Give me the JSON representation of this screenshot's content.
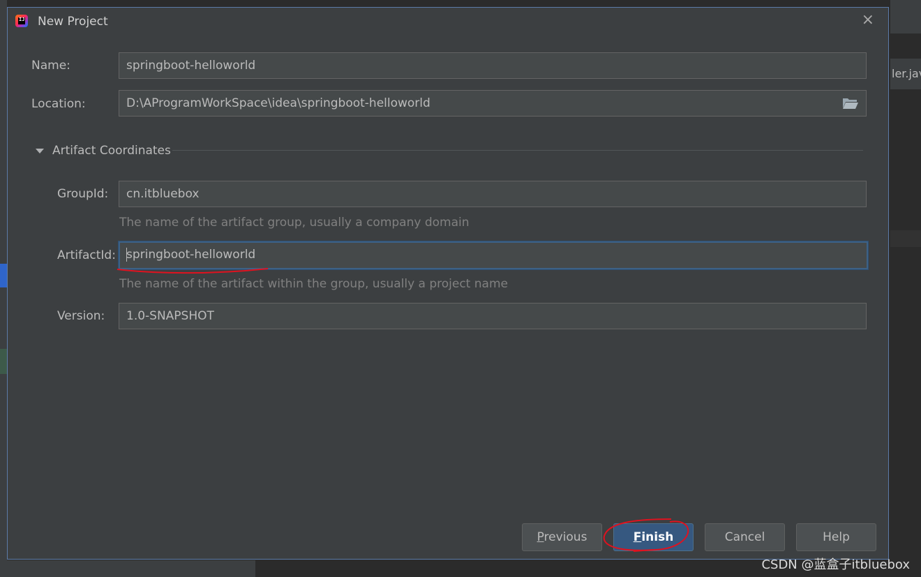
{
  "dialog": {
    "title": "New Project",
    "close_glyph": "×",
    "app_icon": "intellij-idea-icon"
  },
  "form": {
    "name_label": "Name:",
    "name_value": "springboot-helloworld",
    "location_label": "Location:",
    "location_value": "D:\\AProgramWorkSpace\\idea\\springboot-helloworld",
    "browse_icon": "folder-open-icon"
  },
  "artifact": {
    "section_title": "Artifact Coordinates",
    "expanded": true,
    "group_label": "GroupId:",
    "group_value": "cn.itbluebox",
    "group_hint": "The name of the artifact group, usually a company domain",
    "artifact_label": "ArtifactId:",
    "artifact_value": "springboot-helloworld",
    "artifact_hint": "The name of the artifact within the group, usually a project name",
    "version_label": "Version:",
    "version_value": "1.0-SNAPSHOT"
  },
  "buttons": {
    "previous_mnemonic": "P",
    "previous_rest": "revious",
    "finish_mnemonic": "F",
    "finish_rest": "inish",
    "cancel": "Cancel",
    "help": "Help"
  },
  "background": {
    "editor_tab_fragment": "ler.jav",
    "watermark": "CSDN @蓝盒子itbluebox"
  },
  "colors": {
    "dialog_bg": "#3c3f41",
    "field_bg": "#45494a",
    "focus_border": "#3d6185",
    "primary_button": "#365880",
    "annotation_red": "#e0121f"
  }
}
